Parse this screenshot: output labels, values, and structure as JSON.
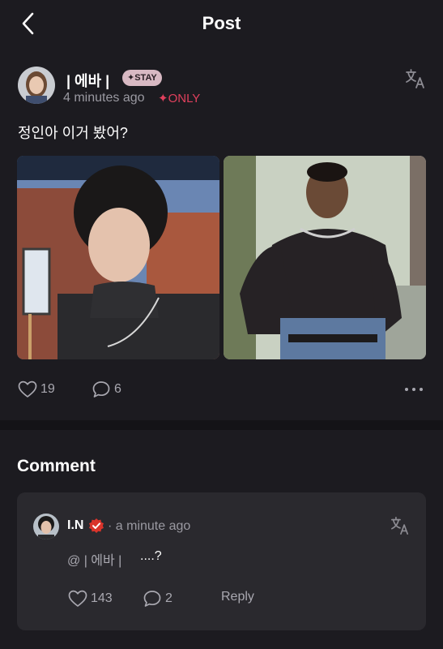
{
  "header": {
    "title": "Post"
  },
  "post": {
    "author": "| 에바 |",
    "stay_badge": "✦STAY",
    "time": "4 minutes ago",
    "only_badge": "✦ONLY",
    "text": "정인아 이거 봤어?",
    "likes": "19",
    "comments": "6"
  },
  "comments_section": {
    "heading": "Comment",
    "items": [
      {
        "author": "I.N",
        "time": "· a minute ago",
        "mention": "@ | 에바 |",
        "text": "....?",
        "likes": "143",
        "comments": "2",
        "reply_label": "Reply"
      }
    ]
  },
  "colors": {
    "background": "#1c1b20",
    "card": "#2a292e",
    "stay_badge": "#d8b9c3",
    "only_accent": "#e0405d",
    "verified": "#d9342b",
    "muted_text": "#9a99a1"
  },
  "icons": [
    "back-arrow-icon",
    "translate-icon",
    "heart-icon",
    "comment-bubble-icon",
    "more-icon",
    "verified-badge-icon"
  ]
}
